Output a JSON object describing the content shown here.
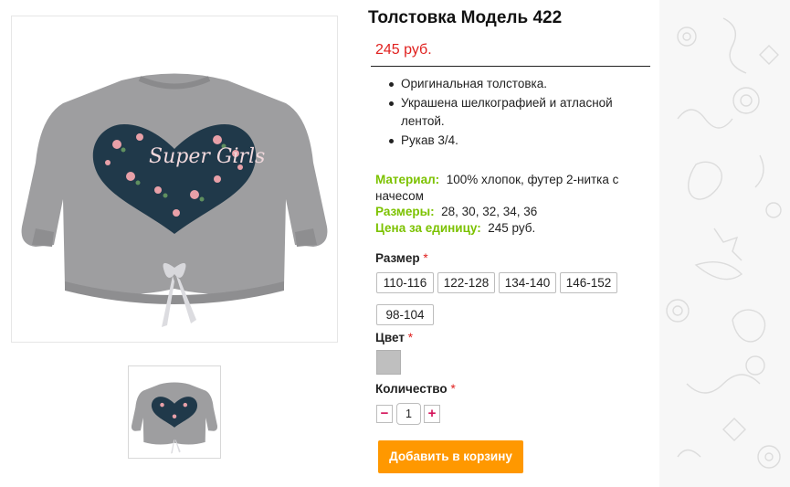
{
  "product": {
    "title": "Толстовка Модель 422",
    "price": "245 руб.",
    "features": [
      "Оригинальная толстовка.",
      "Украшена шелкографией и атласной лентой.",
      "Рукав 3/4."
    ],
    "specs": {
      "material_label": "Материал:",
      "material_value": "100% хлопок, футер 2-нитка с начесом",
      "sizes_label": "Размеры:",
      "sizes_value": "28, 30, 32, 34, 36",
      "unit_price_label": "Цена за единицу:",
      "unit_price_value": "245 руб."
    },
    "image_print_text": "Super Girls"
  },
  "options": {
    "size_label": "Размер",
    "required_mark": "*",
    "sizes": [
      "110-116",
      "122-128",
      "134-140",
      "146-152",
      "98-104"
    ],
    "color_label": "Цвет",
    "color_swatch": "#bfbfbf",
    "quantity_label": "Количество",
    "quantity_value": "1",
    "minus": "−",
    "plus": "+"
  },
  "actions": {
    "add_to_cart": "Добавить в корзину"
  },
  "colors": {
    "price": "#e0201e",
    "spec_key": "#7cc200",
    "cart_button": "#ff9800",
    "qty_buttons": "#d4145a"
  }
}
